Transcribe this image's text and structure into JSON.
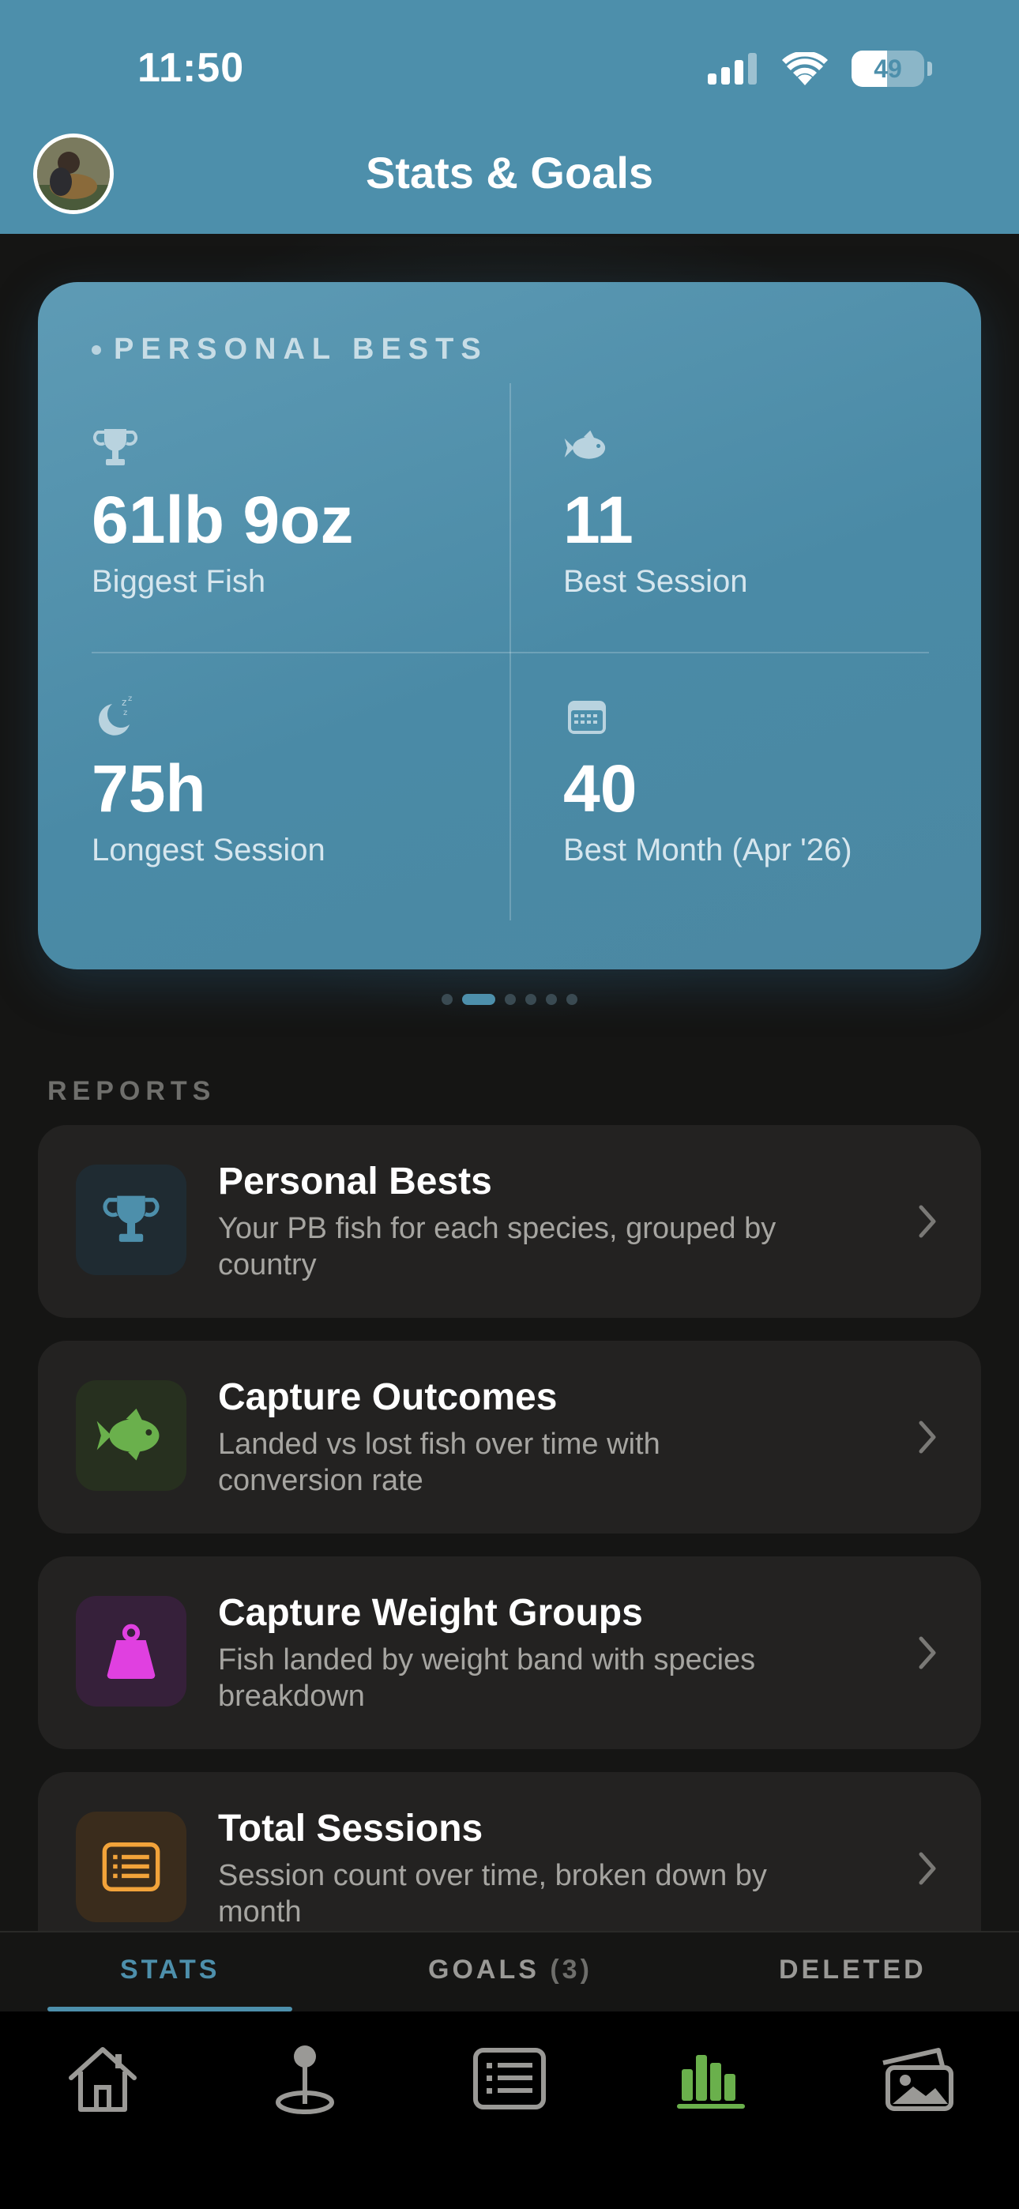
{
  "status_bar": {
    "time": "11:50",
    "battery": "49",
    "battery_level": 0.49
  },
  "header": {
    "title": "Stats & Goals"
  },
  "personal_bests": {
    "heading": "PERSONAL BESTS",
    "stats": [
      {
        "icon": "trophy-icon",
        "value": "61lb 9oz",
        "label": "Biggest Fish"
      },
      {
        "icon": "fish-icon",
        "value": "11",
        "label": "Best Session"
      },
      {
        "icon": "moon-sleep-icon",
        "value": "75h",
        "label": "Longest Session"
      },
      {
        "icon": "calendar-icon",
        "value": "40",
        "label": "Best Month (Apr '26)"
      }
    ],
    "carousel": {
      "pages": 6,
      "active_index": 1
    }
  },
  "reports": {
    "heading": "REPORTS",
    "items": [
      {
        "title": "Personal Bests",
        "description": "Your PB fish for each species, grouped by country",
        "icon": "trophy-icon",
        "icon_color": "#4d8fab",
        "icon_bg": "#1f2b32"
      },
      {
        "title": "Capture Outcomes",
        "description": "Landed vs lost fish over time with conversion rate",
        "icon": "fish-icon",
        "icon_color": "#6ab04c",
        "icon_bg": "#27301f"
      },
      {
        "title": "Capture Weight Groups",
        "description": "Fish landed by weight band with species breakdown",
        "icon": "weight-icon",
        "icon_color": "#e040e0",
        "icon_bg": "#36203a"
      },
      {
        "title": "Total Sessions",
        "description": "Session count over time, broken down by month",
        "icon": "list-icon",
        "icon_color": "#f2a33a",
        "icon_bg": "#3a2c1c"
      }
    ]
  },
  "sub_tabs": {
    "stats": "STATS",
    "goals": "GOALS",
    "goals_count": "(3)",
    "deleted": "DELETED",
    "active": "stats"
  },
  "bottom_nav": {
    "items": [
      "home-icon",
      "location-pin-icon",
      "list-icon",
      "bar-chart-icon",
      "photos-icon"
    ],
    "active": "bar-chart-icon",
    "active_color": "#6ab04c"
  }
}
